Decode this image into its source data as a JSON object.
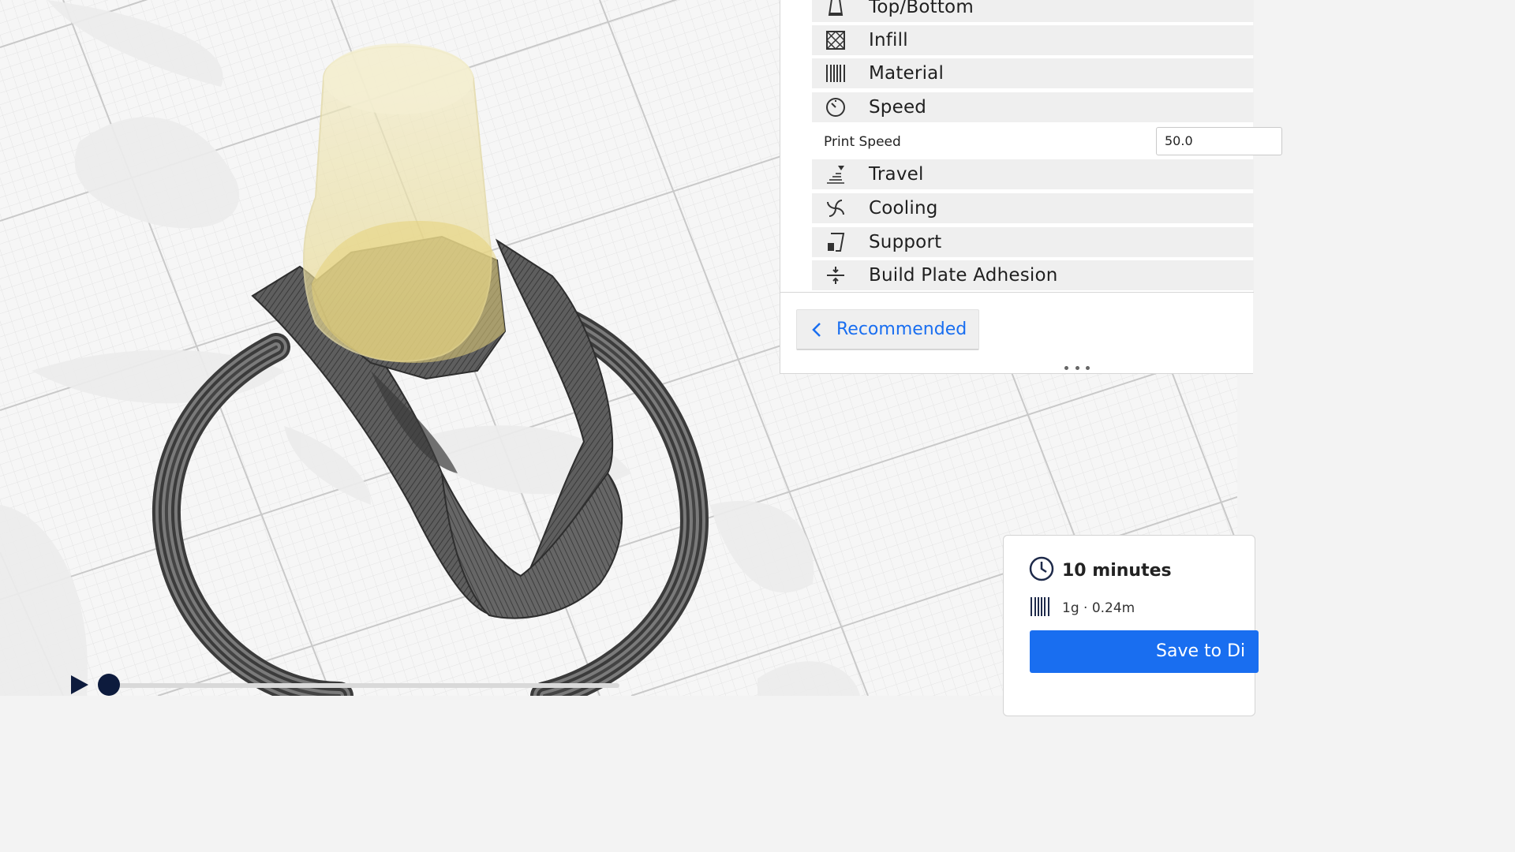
{
  "settings": {
    "categories": [
      {
        "label": "Top/Bottom",
        "icon": "top-bottom-icon"
      },
      {
        "label": "Infill",
        "icon": "infill-icon"
      },
      {
        "label": "Material",
        "icon": "material-icon"
      },
      {
        "label": "Speed",
        "icon": "speed-icon"
      },
      {
        "label": "Travel",
        "icon": "travel-icon"
      },
      {
        "label": "Cooling",
        "icon": "cooling-icon"
      },
      {
        "label": "Support",
        "icon": "support-icon"
      },
      {
        "label": "Build Plate Adhesion",
        "icon": "build-plate-adhesion-icon"
      }
    ],
    "print_speed": {
      "label": "Print Speed",
      "value": "50.0"
    },
    "recommended_label": "Recommended"
  },
  "print_info": {
    "time": "10 minutes",
    "material": "1g · 0.24m",
    "save_label": "Save to Di"
  },
  "colors": {
    "accent": "#196ef0",
    "slider": "#0d1b3d",
    "model_gray": "#5a5a5a",
    "model_highlight": "#e8d98a"
  }
}
